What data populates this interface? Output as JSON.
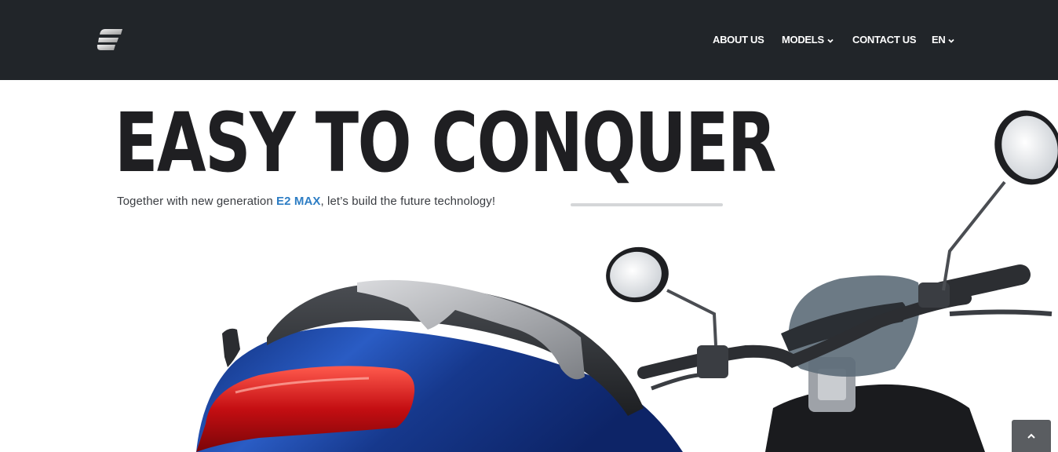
{
  "header": {
    "nav": [
      {
        "label": "ABOUT US",
        "has_dropdown": false
      },
      {
        "label": "MODELS",
        "has_dropdown": true
      },
      {
        "label": "CONTACT US",
        "has_dropdown": false
      },
      {
        "label": "EN",
        "has_dropdown": true
      }
    ]
  },
  "hero": {
    "title": "EASY TO CONQUER",
    "subtitle_prefix": "Together with new generation ",
    "subtitle_highlight": "E2 MAX",
    "subtitle_suffix": ", let’s build the future technology!"
  },
  "icons": {
    "logo": "brand-logo-icon",
    "dropdown": "chevron-down-icon",
    "back_to_top": "chevron-up-icon"
  },
  "colors": {
    "header_bg": "#212529",
    "highlight": "#2d7dc4",
    "title": "#1f1f22",
    "scooter_body": "#1c3f8f",
    "tail_light": "#d81f1f"
  }
}
